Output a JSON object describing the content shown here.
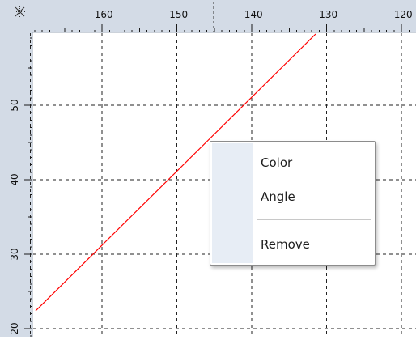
{
  "ruler": {
    "corner_icon": "crosshair-icon",
    "x_ticks": [
      "-160",
      "-150",
      "-140",
      "-130",
      "-120"
    ],
    "y_ticks": [
      "50",
      "40",
      "30",
      "20"
    ]
  },
  "plot": {
    "line_color": "#ff0000",
    "grid_color": "#222222",
    "ruler_color": "#d3dbe6"
  },
  "context_menu": {
    "items": [
      {
        "label": "Color"
      },
      {
        "label": "Angle"
      },
      {
        "label": "Remove"
      }
    ]
  }
}
